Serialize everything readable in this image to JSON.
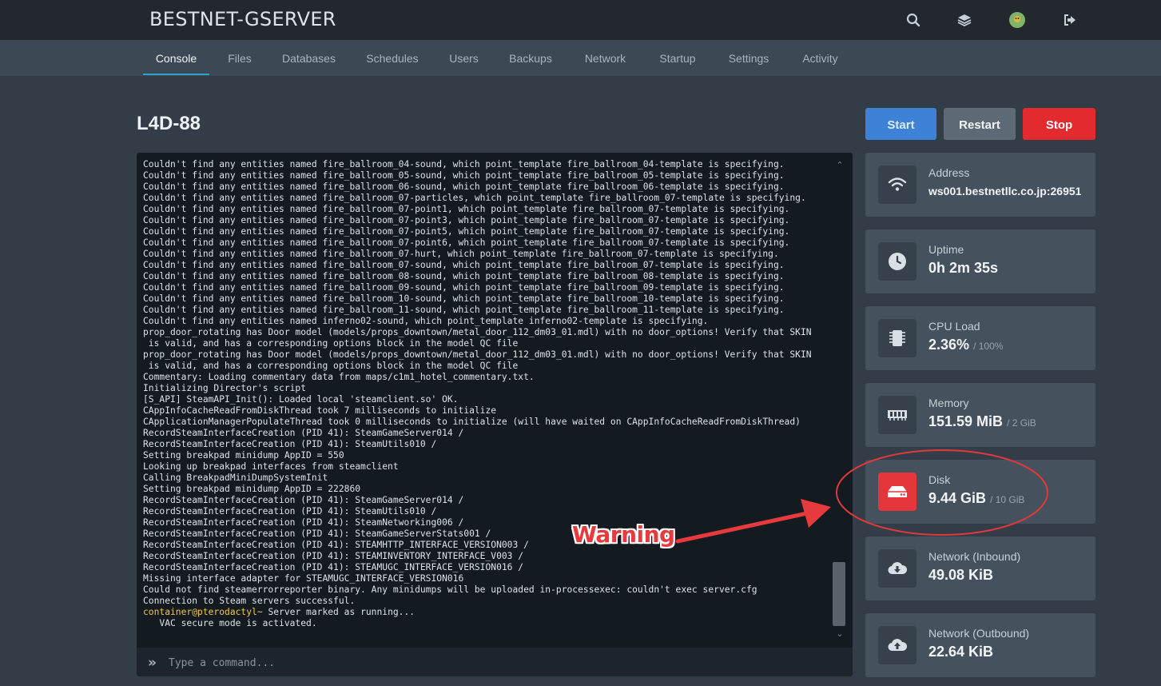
{
  "app": {
    "brand": "BESTNET-GSERVER"
  },
  "topbar_icons": [
    "search-icon",
    "layers-icon",
    "avatar",
    "logout-icon"
  ],
  "tabs": [
    {
      "label": "Console",
      "active": true
    },
    {
      "label": "Files"
    },
    {
      "label": "Databases"
    },
    {
      "label": "Schedules"
    },
    {
      "label": "Users"
    },
    {
      "label": "Backups"
    },
    {
      "label": "Network"
    },
    {
      "label": "Startup"
    },
    {
      "label": "Settings"
    },
    {
      "label": "Activity"
    }
  ],
  "server": {
    "name": "L4D-88"
  },
  "power": {
    "start": "Start",
    "restart": "Restart",
    "stop": "Stop"
  },
  "colors": {
    "start": "#3d82d6",
    "restart": "#5d6975",
    "stop": "#e32b2f",
    "disk_alert": "#e5373b",
    "warning": "#e63a3d"
  },
  "console": {
    "lines": [
      "Couldn't find any entities named fire_ballroom_04-sound, which point_template fire_ballroom_04-template is specifying.",
      "Couldn't find any entities named fire_ballroom_05-sound, which point_template fire_ballroom_05-template is specifying.",
      "Couldn't find any entities named fire_ballroom_06-sound, which point_template fire_ballroom_06-template is specifying.",
      "Couldn't find any entities named fire_ballroom_07-particles, which point_template fire_ballroom_07-template is specifying.",
      "Couldn't find any entities named fire_ballroom_07-point1, which point_template fire_ballroom_07-template is specifying.",
      "Couldn't find any entities named fire_ballroom_07-point3, which point_template fire_ballroom_07-template is specifying.",
      "Couldn't find any entities named fire_ballroom_07-point5, which point_template fire_ballroom_07-template is specifying.",
      "Couldn't find any entities named fire_ballroom_07-point6, which point_template fire_ballroom_07-template is specifying.",
      "Couldn't find any entities named fire_ballroom_07-hurt, which point_template fire_ballroom_07-template is specifying.",
      "Couldn't find any entities named fire_ballroom_07-sound, which point_template fire_ballroom_07-template is specifying.",
      "Couldn't find any entities named fire_ballroom_08-sound, which point_template fire_ballroom_08-template is specifying.",
      "Couldn't find any entities named fire_ballroom_09-sound, which point_template fire_ballroom_09-template is specifying.",
      "Couldn't find any entities named fire_ballroom_10-sound, which point_template fire_ballroom_10-template is specifying.",
      "Couldn't find any entities named fire_ballroom_11-sound, which point_template fire_ballroom_11-template is specifying.",
      "Couldn't find any entities named inferno02-sound, which point_template inferno02-template is specifying.",
      "prop_door_rotating has Door model (models/props_downtown/metal_door_112_dm03_01.mdl) with no door_options! Verify that SKIN",
      " is valid, and has a corresponding options block in the model QC file",
      "prop_door_rotating has Door model (models/props_downtown/metal_door_112_dm03_01.mdl) with no door_options! Verify that SKIN",
      " is valid, and has a corresponding options block in the model QC file",
      "Commentary: Loading commentary data from maps/c1m1_hotel_commentary.txt.",
      "Initializing Director's script",
      "[S_API] SteamAPI_Init(): Loaded local 'steamclient.so' OK.",
      "CAppInfoCacheReadFromDiskThread took 7 milliseconds to initialize",
      "CApplicationManagerPopulateThread took 0 milliseconds to initialize (will have waited on CAppInfoCacheReadFromDiskThread)",
      "RecordSteamInterfaceCreation (PID 41): SteamGameServer014 /",
      "RecordSteamInterfaceCreation (PID 41): SteamUtils010 /",
      "Setting breakpad minidump AppID = 550",
      "Looking up breakpad interfaces from steamclient",
      "Calling BreakpadMiniDumpSystemInit",
      "Setting breakpad minidump AppID = 222860",
      "RecordSteamInterfaceCreation (PID 41): SteamGameServer014 /",
      "RecordSteamInterfaceCreation (PID 41): SteamUtils010 /",
      "RecordSteamInterfaceCreation (PID 41): SteamNetworking006 /",
      "RecordSteamInterfaceCreation (PID 41): SteamGameServerStats001 /",
      "RecordSteamInterfaceCreation (PID 41): STEAMHTTP_INTERFACE_VERSION003 /",
      "RecordSteamInterfaceCreation (PID 41): STEAMINVENTORY_INTERFACE_V003 /",
      "RecordSteamInterfaceCreation (PID 41): STEAMUGC_INTERFACE_VERSION016 /",
      "Missing interface adapter for STEAMUGC_INTERFACE_VERSION016",
      "Could not find steamerrorreporter binary. Any minidumps will be uploaded in-processexec: couldn't exec server.cfg",
      "Connection to Steam servers successful."
    ],
    "prompt_user": "container@pterodactyl~",
    "prompt_message": " Server marked as running...",
    "last_line": "   VAC secure mode is activated.",
    "command_placeholder": "Type a command..."
  },
  "stats": [
    {
      "key": "address",
      "label": "Address",
      "value": "ws001.bestnetllc.co.jp:26951",
      "sub": "",
      "icon": "wifi-icon"
    },
    {
      "key": "uptime",
      "label": "Uptime",
      "value": "0h 2m 35s",
      "sub": "",
      "icon": "clock-icon"
    },
    {
      "key": "cpu",
      "label": "CPU Load",
      "value": "2.36%",
      "sub": "/ 100%",
      "icon": "cpu-icon"
    },
    {
      "key": "memory",
      "label": "Memory",
      "value": "151.59 MiB",
      "sub": "/ 2 GiB",
      "icon": "memory-icon"
    },
    {
      "key": "disk",
      "label": "Disk",
      "value": "9.44 GiB",
      "sub": "/ 10 GiB",
      "icon": "disk-icon",
      "alert": true
    },
    {
      "key": "net_in",
      "label": "Network (Inbound)",
      "value": "49.08 KiB",
      "sub": "",
      "icon": "cloud-download-icon"
    },
    {
      "key": "net_out",
      "label": "Network (Outbound)",
      "value": "22.64 KiB",
      "sub": "",
      "icon": "cloud-upload-icon"
    }
  ],
  "annotation": {
    "text": "Warning"
  }
}
